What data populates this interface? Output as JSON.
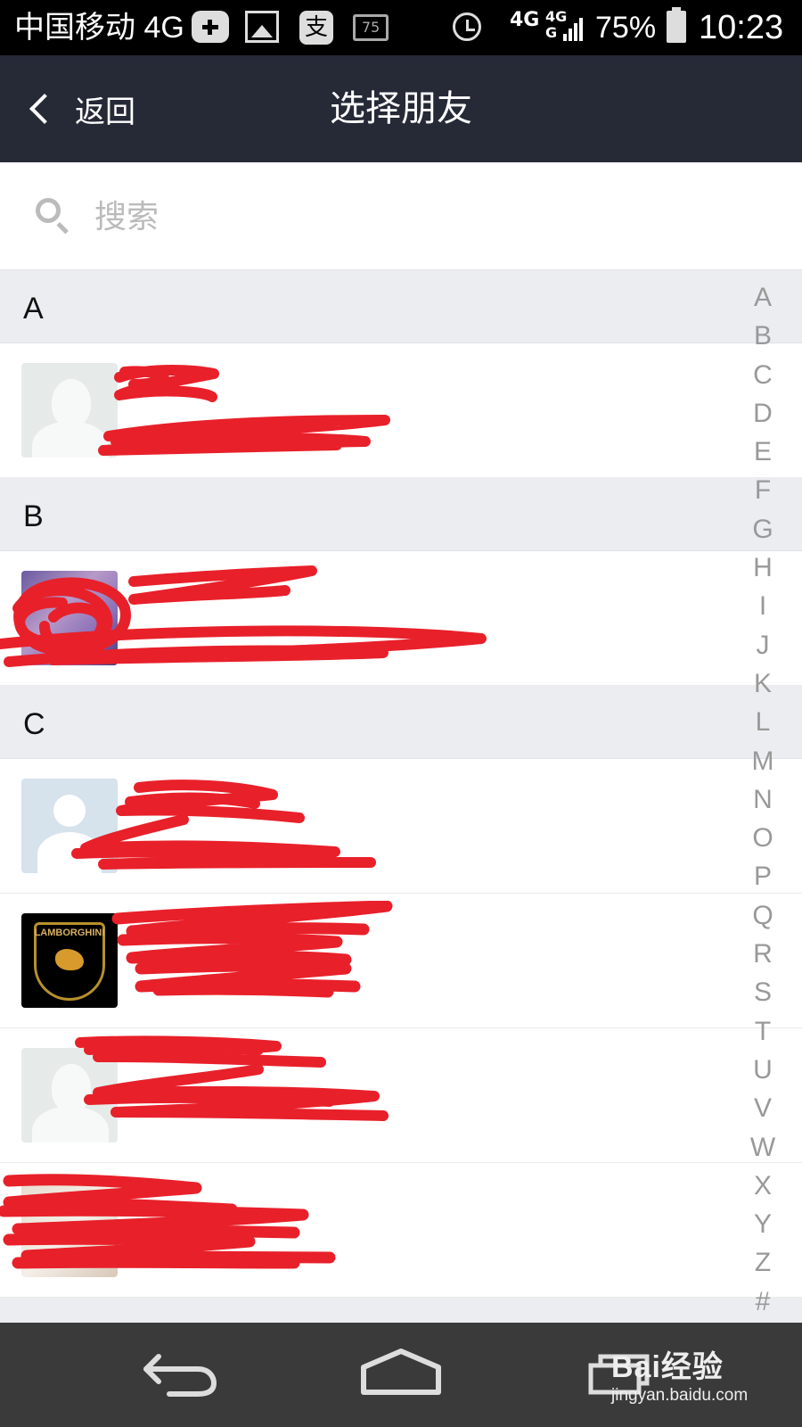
{
  "status_bar": {
    "carrier": "中国移动 4G",
    "alipay_glyph": "支",
    "battery_icon_label": "75",
    "network_1": "4G",
    "network_2": "4G",
    "network_2b": "G",
    "battery": "75%",
    "time": "10:23",
    "icons": [
      "plus-icon",
      "image-icon",
      "alipay-icon",
      "battery75-icon",
      "alarm-icon",
      "signal-icon",
      "battery-icon"
    ]
  },
  "header": {
    "back_label": "返回",
    "title": "选择朋友",
    "background": "#262a37"
  },
  "search": {
    "placeholder": "搜索",
    "value": ""
  },
  "sections": [
    {
      "letter": "A"
    },
    {
      "letter": "B"
    },
    {
      "letter": "C"
    }
  ],
  "contacts": [
    {
      "section": "A",
      "avatar": "silhouette",
      "name": "",
      "phone": ""
    },
    {
      "section": "B",
      "avatar": "photo",
      "name": "",
      "phone": ""
    },
    {
      "section": "C",
      "avatar": "person",
      "name": "",
      "phone": ""
    },
    {
      "section": "C",
      "avatar": "lamborghini-logo",
      "logo_text": "LAMBORGHINI",
      "name": "",
      "phone": ""
    },
    {
      "section": "C",
      "avatar": "silhouette",
      "name": "",
      "phone": ""
    },
    {
      "section": "C",
      "avatar": "photo",
      "name": "",
      "phone": ""
    }
  ],
  "alpha_index": [
    "A",
    "B",
    "C",
    "D",
    "E",
    "F",
    "G",
    "H",
    "I",
    "J",
    "K",
    "L",
    "M",
    "N",
    "O",
    "P",
    "Q",
    "R",
    "S",
    "T",
    "U",
    "V",
    "W",
    "X",
    "Y",
    "Z",
    "#"
  ],
  "nav_bar": {
    "icons": [
      "nav-back-icon",
      "nav-home-icon",
      "nav-recent-icon"
    ]
  },
  "watermark": {
    "brand": "Bai经验",
    "url": "jingyan.baidu.com"
  },
  "colors": {
    "header_bg": "#262a37",
    "section_bg": "#ecedf1",
    "index_text": "#999999",
    "redaction": "#e8202a",
    "nav_bg": "#3a3a3a"
  }
}
